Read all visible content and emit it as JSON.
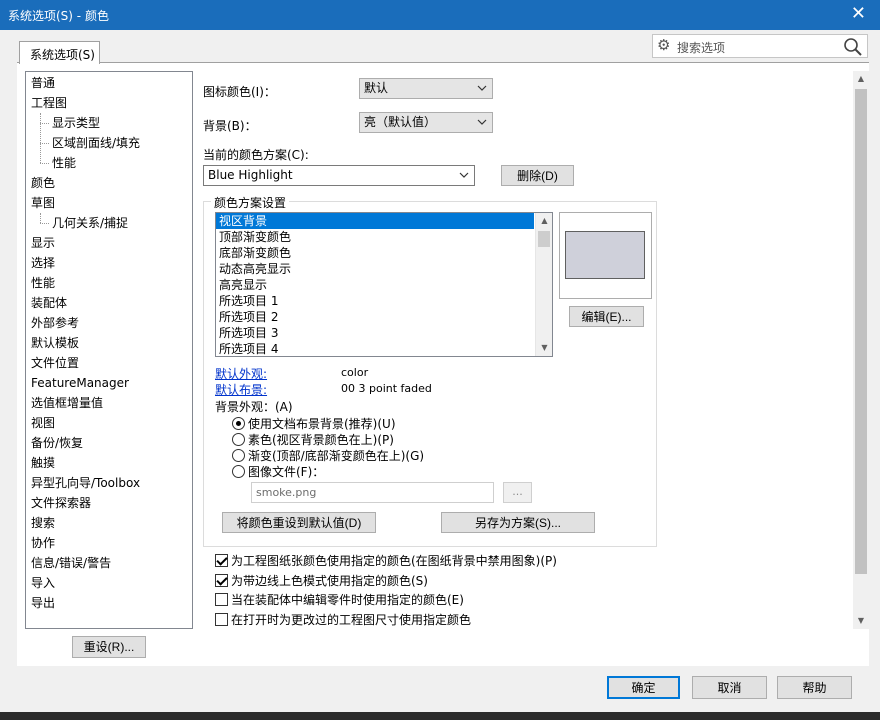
{
  "window": {
    "title": "系统选项(S) - 颜色",
    "close_glyph": "✕"
  },
  "tab": {
    "label": "系统选项(S)"
  },
  "search": {
    "placeholder": "搜索选项"
  },
  "tree": {
    "items": [
      {
        "label": "普通",
        "child": false
      },
      {
        "label": "工程图",
        "child": false
      },
      {
        "label": "显示类型",
        "child": true
      },
      {
        "label": "区域剖面线/填充",
        "child": true
      },
      {
        "label": "性能",
        "child": true
      },
      {
        "label": "颜色",
        "child": false
      },
      {
        "label": "草图",
        "child": false
      },
      {
        "label": "几何关系/捕捉",
        "child": true
      },
      {
        "label": "显示",
        "child": false
      },
      {
        "label": "选择",
        "child": false
      },
      {
        "label": "性能",
        "child": false
      },
      {
        "label": "装配体",
        "child": false
      },
      {
        "label": "外部参考",
        "child": false
      },
      {
        "label": "默认模板",
        "child": false
      },
      {
        "label": "文件位置",
        "child": false
      },
      {
        "label": "FeatureManager",
        "child": false
      },
      {
        "label": "选值框增量值",
        "child": false
      },
      {
        "label": "视图",
        "child": false
      },
      {
        "label": "备份/恢复",
        "child": false
      },
      {
        "label": "触摸",
        "child": false
      },
      {
        "label": "异型孔向导/Toolbox",
        "child": false
      },
      {
        "label": "文件探索器",
        "child": false
      },
      {
        "label": "搜索",
        "child": false
      },
      {
        "label": "协作",
        "child": false
      },
      {
        "label": "信息/错误/警告",
        "child": false
      },
      {
        "label": "导入",
        "child": false
      },
      {
        "label": "导出",
        "child": false
      }
    ]
  },
  "reset_button": "重设(R)...",
  "icon_color": {
    "label": "图标颜色(I)：",
    "value": "默认"
  },
  "background": {
    "label": "背景(B)：",
    "value": "亮（默认值）"
  },
  "scheme": {
    "label": "当前的颜色方案(C):",
    "value": "Blue Highlight",
    "delete_button": "删除(D)"
  },
  "scheme_settings": {
    "title": "颜色方案设置",
    "items": [
      "视区背景",
      "顶部渐变颜色",
      "底部渐变颜色",
      "动态高亮显示",
      "高亮显示",
      "所选项目 1",
      "所选项目 2",
      "所选项目 3",
      "所选项目 4"
    ],
    "selected_index": 0,
    "edit_button": "编辑(E)...",
    "swatch_color": "#cfd0da"
  },
  "defaults": {
    "appearance_label": "默认外观:",
    "appearance_value": "color",
    "scene_label": "默认布景:",
    "scene_value": "00 3 point faded"
  },
  "bg_appearance": {
    "label": "背景外观：(A)",
    "options": [
      {
        "label": "使用文档布景背景(推荐)(U)",
        "checked": true
      },
      {
        "label": "素色(视区背景颜色在上)(P)",
        "checked": false
      },
      {
        "label": "渐变(顶部/底部渐变颜色在上)(G)",
        "checked": false
      },
      {
        "label": "图像文件(F)：",
        "checked": false
      }
    ],
    "file_value": "smoke.png",
    "browse_label": "..."
  },
  "reset_colors_button": "将颜色重设到默认值(D)",
  "save_as_button": "另存为方案(S)...",
  "checkboxes": [
    {
      "label": "为工程图纸张颜色使用指定的颜色(在图纸背景中禁用图象)(P)",
      "checked": true
    },
    {
      "label": "为带边线上色模式使用指定的颜色(S)",
      "checked": true
    },
    {
      "label": "当在装配体中编辑零件时使用指定的颜色(E)",
      "checked": false
    },
    {
      "label": "在打开时为更改过的工程图尺寸使用指定颜色",
      "checked": false
    }
  ],
  "footer": {
    "ok": "确定",
    "cancel": "取消",
    "help": "帮助"
  },
  "colors": {
    "titlebar": "#1a6dbb",
    "selection": "#0078d7"
  }
}
